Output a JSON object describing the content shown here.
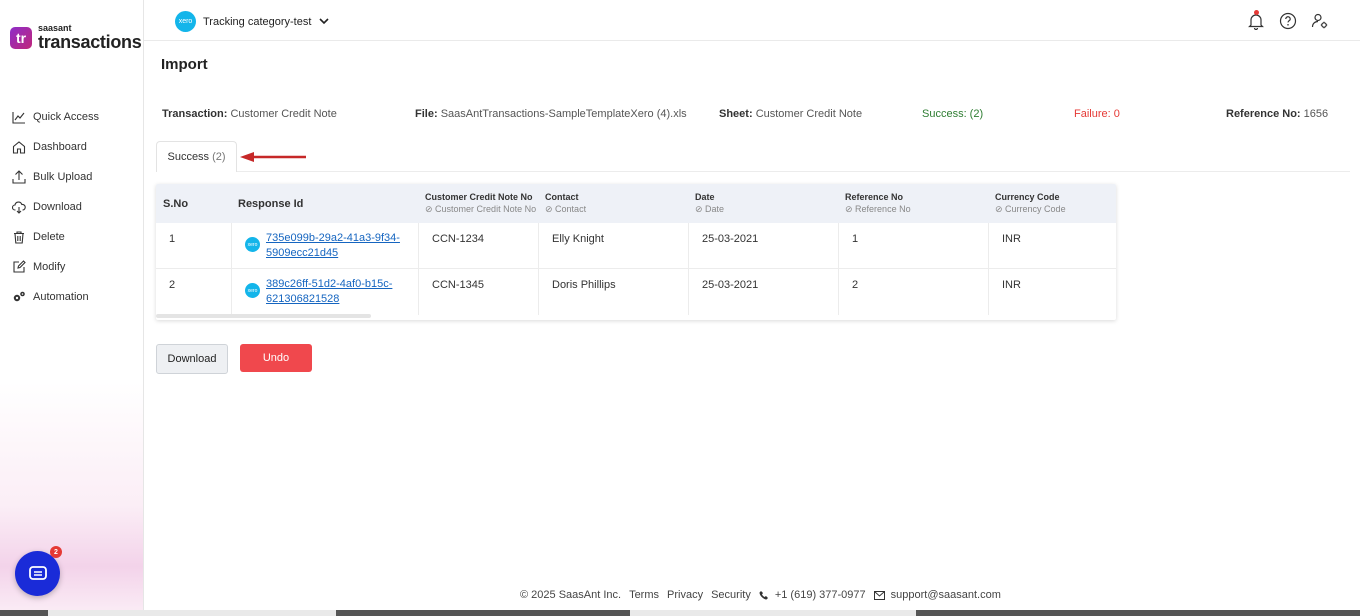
{
  "brand": {
    "small": "saasant",
    "big": "transactions",
    "mark": "tr"
  },
  "sidebar": {
    "items": [
      {
        "label": "Quick Access",
        "icon": "chart-line-icon"
      },
      {
        "label": "Dashboard",
        "icon": "home-icon"
      },
      {
        "label": "Bulk Upload",
        "icon": "upload-icon"
      },
      {
        "label": "Download",
        "icon": "cloud-download-icon"
      },
      {
        "label": "Delete",
        "icon": "trash-icon"
      },
      {
        "label": "Modify",
        "icon": "edit-icon"
      },
      {
        "label": "Automation",
        "icon": "gears-icon"
      }
    ]
  },
  "chat": {
    "badge": "2"
  },
  "header": {
    "org_logo_text": "xero",
    "org_name": "Tracking category-test"
  },
  "page": {
    "title": "Import"
  },
  "summary": {
    "transaction_label": "Transaction:",
    "transaction_value": "Customer Credit Note",
    "file_label": "File:",
    "file_value": "SaasAntTransactions-SampleTemplateXero (4).xls",
    "sheet_label": "Sheet:",
    "sheet_value": "Customer Credit Note",
    "success_text": "Success: (2)",
    "failure_text": "Failure: 0",
    "reference_label": "Reference No:",
    "reference_value": "1656"
  },
  "tabs": [
    {
      "label": "Success",
      "count": "(2)"
    }
  ],
  "table": {
    "columns": [
      {
        "label": "S.No",
        "sub": ""
      },
      {
        "label": "Response Id",
        "sub": ""
      },
      {
        "label": "Customer Credit Note No",
        "sub": "Customer Credit Note No"
      },
      {
        "label": "Contact",
        "sub": "Contact"
      },
      {
        "label": "Date",
        "sub": "Date"
      },
      {
        "label": "Reference No",
        "sub": "Reference No"
      },
      {
        "label": "Currency Code",
        "sub": "Currency Code"
      }
    ],
    "rows": [
      {
        "sno": "1",
        "response_line1": "735e099b-29a2-41a3-9f34-",
        "response_line2": "5909ecc21d45",
        "note_no": "CCN-1234",
        "contact": "Elly Knight",
        "date": "25-03-2021",
        "reference": "1",
        "currency": "INR"
      },
      {
        "sno": "2",
        "response_line1": "389c26ff-51d2-4af0-b15c-",
        "response_line2": "621306821528",
        "note_no": "CCN-1345",
        "contact": "Doris Phillips",
        "date": "25-03-2021",
        "reference": "2",
        "currency": "INR"
      }
    ]
  },
  "actions": {
    "download_label": "Download",
    "undo_label": "Undo"
  },
  "footer": {
    "copyright": "© 2025 SaasAnt Inc.",
    "terms": "Terms",
    "privacy": "Privacy",
    "security": "Security",
    "phone": "+1 (619) 377-0977",
    "email": "support@saasant.com"
  },
  "colors": {
    "success": "#2e7d32",
    "failure": "#e53935",
    "undo": "#f0484d",
    "chat": "#1a2bd8",
    "xero": "#13b5ea"
  }
}
